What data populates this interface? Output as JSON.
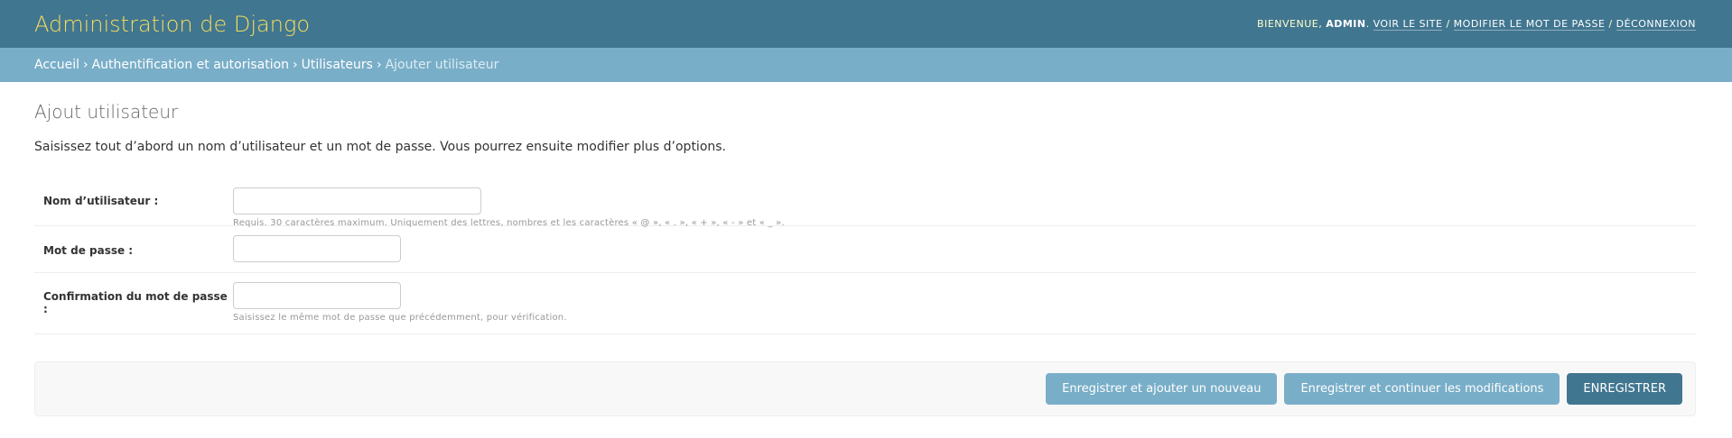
{
  "header": {
    "site_title": "Administration de Django",
    "welcome": "Bienvenue,",
    "user_name": "admin",
    "user_suffix": ".",
    "view_site": "Voir le site",
    "change_password": "Modifier le mot de passe",
    "logout": "Déconnexion",
    "separator": "/"
  },
  "breadcrumbs": {
    "home": "Accueil",
    "app": "Authentification et autorisation",
    "model": "Utilisateurs",
    "current": "Ajouter utilisateur",
    "separator": "›"
  },
  "page": {
    "title": "Ajout utilisateur",
    "intro": "Saisissez tout d’abord un nom d’utilisateur et un mot de passe. Vous pourrez ensuite modifier plus d’options."
  },
  "form": {
    "username": {
      "label": "Nom d’utilisateur :",
      "value": "",
      "help": "Requis. 30 caractères maximum. Uniquement des lettres, nombres et les caractères « @ », « . », « + », « - » et « _ »."
    },
    "password1": {
      "label": "Mot de passe :",
      "value": ""
    },
    "password2": {
      "label": "Confirmation du mot de passe :",
      "value": "",
      "help": "Saisissez le même mot de passe que précédemment, pour vérification."
    }
  },
  "submit": {
    "save_add_another": "Enregistrer et ajouter un nouveau",
    "save_continue": "Enregistrer et continuer les modifications",
    "save": "Enregistrer"
  },
  "colors": {
    "header_bg": "#417690",
    "breadcrumbs_bg": "#79aec8",
    "branding": "#f5dd5d",
    "primary_button": "#417690",
    "secondary_button": "#79aec8"
  }
}
